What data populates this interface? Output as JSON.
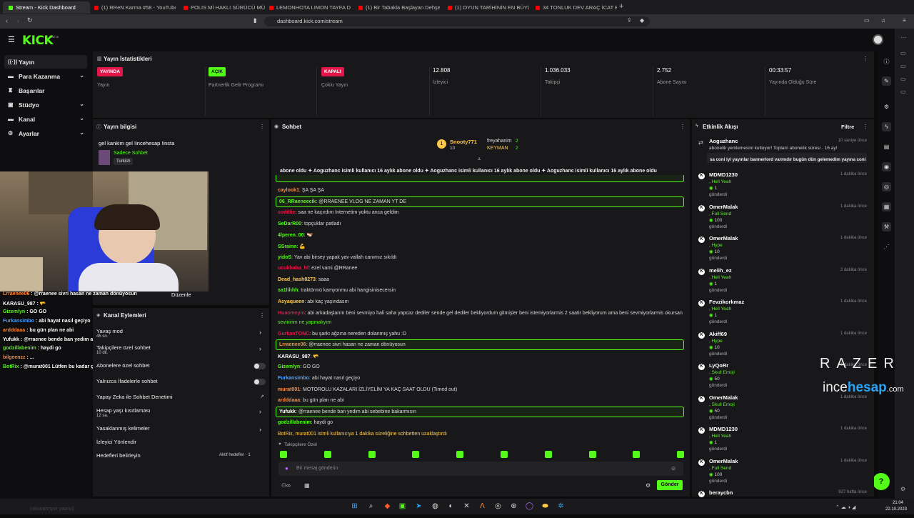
{
  "browser": {
    "tabs": [
      {
        "label": "Stream - Kick Dashboard",
        "color": "#53fc18"
      },
      {
        "label": "(1) RReN Karma #58 - YouTube",
        "color": "#ff0000"
      },
      {
        "label": "POLIS Mİ HAKLI SÜRÜCÜ MÜ? | Sin",
        "color": "#ff0000"
      },
      {
        "label": "LEMONHOTA LIMON TAYFA DERLEM",
        "color": "#ff0000"
      },
      {
        "label": "(1) Bir Tabakla Başlayan Dehşet: İvan",
        "color": "#ff0000"
      },
      {
        "label": "(1) OYUN TARİHİNİN EN BÜYÜK KON",
        "color": "#ff0000"
      },
      {
        "label": "34 TONLUK DEV ARAÇ İCAT EDİP BU",
        "color": "#ff0000"
      }
    ],
    "url": "dashboard.kick.com/stream",
    "new_tab": "+"
  },
  "brand": {
    "logo": "KICK",
    "beta": "BETA",
    "color": "#53fc18"
  },
  "sidebar": {
    "items": [
      {
        "label": "Yayın",
        "icon": "broadcast-icon",
        "icon_glyph": "((·))",
        "chev": ""
      },
      {
        "label": "Para Kazanma",
        "icon": "money-icon",
        "icon_glyph": "▬",
        "chev": "⌄"
      },
      {
        "label": "Başarılar",
        "icon": "trophy-icon",
        "icon_glyph": "♜",
        "chev": ""
      },
      {
        "label": "Stüdyo",
        "icon": "studio-icon",
        "icon_glyph": "▣",
        "chev": "⌄"
      },
      {
        "label": "Kanal",
        "icon": "channel-icon",
        "icon_glyph": "▬",
        "chev": "⌄"
      },
      {
        "label": "Ayarlar",
        "icon": "settings-icon",
        "icon_glyph": "⚙",
        "chev": "⌄"
      }
    ]
  },
  "stats": {
    "title": "Yayın İstatistikleri",
    "cells": [
      {
        "badge": "YAYINDA",
        "badge_color": "#e3164a",
        "label": "Yayın"
      },
      {
        "badge": "AÇIK",
        "badge_color": "#53fc18",
        "label": "Partnerlik Gelir Programı"
      },
      {
        "badge": "KAPALI",
        "badge_color": "#e3164a",
        "label": "Çoklu Yayın"
      },
      {
        "value": "12.808",
        "label": "İzleyici"
      },
      {
        "value": "1.036.033",
        "label": "Takipçi"
      },
      {
        "value": "2.752",
        "label": "Abone Sayısı"
      },
      {
        "value": "00:33:57",
        "label": "Yayında Olduğu Süre"
      }
    ]
  },
  "stream_info": {
    "title": "Yayın bilgisi",
    "stream_title": "gel kankim gel !incehesap !insta",
    "category": "Sadece Sohbet",
    "tag": "Turkish",
    "edit": "Düzenle"
  },
  "channel_actions": {
    "title": "Kanal Eylemleri",
    "items": [
      {
        "label": "Yavaş mod",
        "sub": "45 sn.",
        "control": "chevron"
      },
      {
        "label": "Takipçilere özel sohbet",
        "sub": "10 dk.",
        "control": "chevron"
      },
      {
        "label": "Abonelere özel sohbet",
        "sub": "",
        "control": "toggle"
      },
      {
        "label": "Yalnızca İfadelerle sohbet",
        "sub": "",
        "control": "toggle"
      },
      {
        "label": "Yapay Zeka ile Sohbet Denetimi",
        "sub": "",
        "control": "link"
      },
      {
        "label": "Hesap yaşı kısıtlaması",
        "sub": "12 sa.",
        "control": "chevron"
      },
      {
        "label": "Yasaklanmış kelimeler",
        "sub": "",
        "control": "chevron"
      },
      {
        "label": "İzleyici Yönlendir",
        "sub": "",
        "control": ""
      },
      {
        "label": "Hedefleri belirleyin",
        "sub": "",
        "control": "goals"
      }
    ],
    "goals_label": "Aktif hedefler · 1"
  },
  "overlay_chat": [
    {
      "user": "Lrraenee06",
      "user_color": "#ff8b3d",
      "text": "@rraenee sivri hasan ne zaman dönüyosun"
    },
    {
      "user": "KARASU_987",
      "user_color": "#ffffff",
      "text": "🫳"
    },
    {
      "user": "Gizemlyn",
      "user_color": "#53fc18",
      "text": "GO GO"
    },
    {
      "user": "Furkansimbo",
      "user_color": "#4ea1ff",
      "text": "abi hayat nasıl geçiyo"
    },
    {
      "user": "ardddaaa",
      "user_color": "#ff8b3d",
      "text": "bu gün plan ne abi"
    },
    {
      "user": "Yufukk",
      "user_color": "#ffffff",
      "text": "@rraenee bende ban yedim abi sebebine bakarmısın"
    },
    {
      "user": "godzillabenim",
      "user_color": "#53fc18",
      "text": "haydi go"
    },
    {
      "user": "bilgeenzz",
      "user_color": "#ff8b3d",
      "text": "..."
    },
    {
      "user": "BotRix",
      "user_color": "#53fc18",
      "text": "@murat001 Lütfen bu kadar çok büyük harf göndermeyin."
    }
  ],
  "chat": {
    "title": "Sohbet",
    "top_gifters": [
      {
        "name": "Snooty771",
        "count": "10"
      },
      {
        "name": "freyahanim",
        "count": "2"
      },
      {
        "name": "KEYMAN",
        "count": "2"
      }
    ],
    "ticker": "abone oldu  ✦ Aoguzhanc isimli kullanıcı 16 aylık abone oldu  ✦ Aoguzhanc isimli kullanıcı 16 aylık abone oldu  ✦ Aoguzhanc isimli kullanıcı 16 aylık abone oldu",
    "messages": [
      {
        "user": "caylook1",
        "color": "#ff8b3d",
        "text": "ŞA ŞA ŞA",
        "hl": false
      },
      {
        "user": "06_RRaeneecik",
        "color": "#53fc18",
        "text": "@RRAENEE VLOG NE ZAMAN YT DE",
        "hl": true
      },
      {
        "user": "soddiie",
        "color": "#e3164a",
        "text": "saa ne kaçırdım İnternetim yoktu anca geldim",
        "hl": false
      },
      {
        "user": "SeDarR00",
        "color": "#53fc18",
        "text": "topçuklar patladı",
        "hl": false
      },
      {
        "user": "4lperen_00",
        "color": "#53fc18",
        "text": "🫱🏻‍🫲🏾",
        "hl": false
      },
      {
        "user": "SSrainn",
        "color": "#53fc18",
        "text": "💪",
        "hl": false
      },
      {
        "user": "yidoS",
        "color": "#53fc18",
        "text": "Yav abi birsey yapak yav vallah canımız sıkıldı",
        "hl": false
      },
      {
        "user": "ucukbaba_hf",
        "color": "#e3164a",
        "text": "ezel vami @RRanee",
        "hl": false
      },
      {
        "user": "Dead_hash8273",
        "color": "#ffc94a",
        "text": "saaa",
        "hl": false
      },
      {
        "user": "sa1lihhh",
        "color": "#53fc18",
        "text": "traktörmü kamyonmu abi hangisinisecersin",
        "hl": false
      },
      {
        "user": "Asyaqueen",
        "color": "#ffc94a",
        "text": "abi kaç yaşındasın",
        "hl": false
      },
      {
        "user": "Huaomeyin",
        "color": "#e3164a",
        "text": "abi arkadaşlarım beni sevmiyo hali saha yapcaz dediler sende gel dediler bekliyordum gitmişler beni istemiyorlarmis 2 saatir bekliyorum ama beni sevmiyorlarmis okursan",
        "hl": false
      },
      {
        "user": "",
        "color": "#53fc18",
        "text": "sevinirim ne yapmalıyım",
        "hl": false
      },
      {
        "user": "GurkanTONC",
        "color": "#e3164a",
        "text": "bu şarkı ağzına nereden dolanmış yahu :D",
        "hl": false
      },
      {
        "user": "Lrraenee06",
        "color": "#ff8b3d",
        "text": "@rraenee sivri hasan ne zaman dönüyosun",
        "hl": true
      },
      {
        "user": "KARASU_987",
        "color": "#ffffff",
        "text": "🫳",
        "hl": false
      },
      {
        "user": "Gizemlyn",
        "color": "#53fc18",
        "text": "GO GO",
        "hl": false
      },
      {
        "user": "Furkansimbo",
        "color": "#4ea1ff",
        "text": "abi hayat nasıl geçiyo",
        "hl": false
      },
      {
        "user": "murat001",
        "color": "#ff8b3d",
        "text": "MOTOROLU KAZALARI İZLİYELİM YA KAÇ SAAT OLDU (Timed out)",
        "hl": false
      },
      {
        "user": "ardddaaa",
        "color": "#ff8b3d",
        "text": "bu gün plan ne abi",
        "hl": false
      },
      {
        "user": "Yufukk",
        "color": "#ffffff",
        "text": "@rraenee bende ban yedim abi sebebine bakarmısın",
        "hl": true
      },
      {
        "user": "godzillabenim",
        "color": "#53fc18",
        "text": "haydi go",
        "hl": false
      },
      {
        "user": "",
        "color": "#ffc94a",
        "text": "BotRix, murat001 isimli kullanıcıya 1 dakika süreliğine sohbetten uzaklaştırdı",
        "hl": false
      }
    ],
    "followers_only_label": "Takipçilere Özel",
    "placeholder": "Bir mesaj gönderin",
    "send": "Gönder"
  },
  "activity": {
    "title": "Etkinlik Akışı",
    "filter": "Filtre",
    "items": [
      {
        "name": "Aoguzhanc",
        "time": "10 saniye önce",
        "desc": "abonelik yenilemesini kutluyor! Toplam abonelik süresi · 16 ay!",
        "note": "sa coni iyi yayınlar bannerlord varmıdır bugün dün gelemedim yayına coni"
      },
      {
        "name": "MDMD1230",
        "time": "1 dakika önce",
        "line1": ", Hell Yeah",
        "line2": "1",
        "line3": "gönderdi"
      },
      {
        "name": "OmerMalak",
        "time": "1 dakika önce",
        "line1": ", Full Send",
        "line2": "100",
        "line3": "gönderdi"
      },
      {
        "name": "OmerMalak",
        "time": "1 dakika önce",
        "line1": ", Hype",
        "line2": "10",
        "line3": "gönderdi"
      },
      {
        "name": "melih_ez",
        "time": "2 dakika önce",
        "line1": ", Hell Yeah",
        "line2": "1",
        "line3": "gönderdi"
      },
      {
        "name": "Fevzikorkmaz",
        "time": "1 dakika önce",
        "line1": ", Hell Yeah",
        "line2": "1",
        "line3": "gönderdi"
      },
      {
        "name": "Akiff69",
        "time": "1 dakika önce",
        "line1": ", Hype",
        "line2": "10",
        "line3": "gönderdi"
      },
      {
        "name": "LyQoRr",
        "time": "1 dakika önce",
        "line1": ", Skull Emoji",
        "line2": "50",
        "line3": "gönderdi"
      },
      {
        "name": "OmerMalak",
        "time": "1 dakika önce",
        "line1": ", Skull Emoji",
        "line2": "50",
        "line3": "gönderdi"
      },
      {
        "name": "MDMD1230",
        "time": "1 dakika önce",
        "line1": ", Hell Yeah",
        "line2": "1",
        "line3": "gönderdi"
      },
      {
        "name": "OmerMalak",
        "time": "1 dakika önce",
        "line1": ", Full Send",
        "line2": "100",
        "line3": "gönderdi"
      },
      {
        "name": "beraycbn",
        "time": "927 hafta önce"
      }
    ]
  },
  "watermark": {
    "razer": "RAZER",
    "ince": "ince",
    "hesap": "hesap",
    ".com": ".com"
  },
  "taskbar": {
    "time": "21:04",
    "date": "22.10.2023",
    "bottom_text": "(okunamıyor yazısı)"
  }
}
